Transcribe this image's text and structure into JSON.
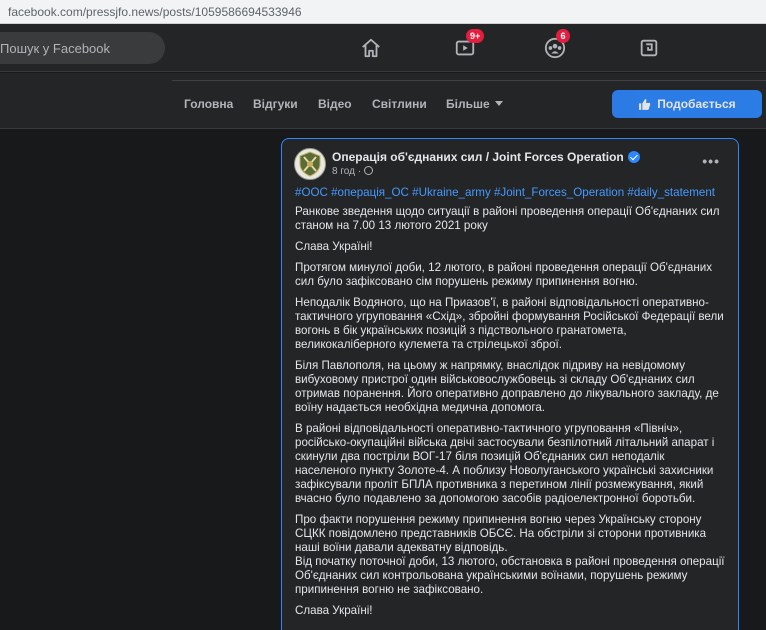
{
  "browser": {
    "url": "facebook.com/pressjfo.news/posts/1059586694533946"
  },
  "topnav": {
    "search_placeholder": "Пошук у Facebook",
    "icons": [
      "home-icon",
      "watch-icon",
      "groups-icon",
      "gaming-icon"
    ],
    "watch_badge": "9+",
    "groups_badge": "6"
  },
  "pagenav": {
    "tabs": [
      "Головна",
      "Відгуки",
      "Відео",
      "Світлини",
      "Більше"
    ],
    "like_button": "Подобається"
  },
  "post": {
    "page_name": "Операція об'єднаних сил / Joint Forces Operation",
    "time": "8 год ·",
    "hashtags": "#ООС #операція_ОС #Ukraine_army #Joint_Forces_Operation #daily_statement",
    "paragraphs": [
      "Ранкове зведення щодо ситуації в районі проведення операції Об'єднаних сил станом на 7.00 13 лютого 2021 року",
      "Слава Україні!",
      "Протягом минулої доби, 12 лютого, в районі проведення операції Об'єднаних сил було зафіксовано сім порушень режиму припинення вогню.",
      "Неподалік Водяного, що на Приазов'ї, в районі відповідальності оперативно-тактичного угруповання «Схід», збройні формування Російської Федерації вели вогонь в бік українських позицій з підствольного гранатомета, великокаліберного кулемета та стрілецької зброї.",
      "Біля Павлополя, на цьому ж напрямку, внаслідок підриву на невідомому вибуховому пристрої один військовослужбовець зі складу Об'єднаних сил отримав поранення. Його оперативно доправлено до лікувального закладу, де воїну надається необхідна медична допомога.",
      "В районі відповідальності оперативно-тактичного угруповання «Північ», російсько-окупаційні війська двічі застосували безпілотний літальний апарат і скинули два постріли ВОГ-17 біля позицій Об'єднаних сил неподалік населеного пункту Золоте-4. А поблизу Новолуганського українські захисники зафіксували проліт БПЛА противника з перетином лінії розмежування, який вчасно було подавлено за допомогою засобів радіоелектронної боротьби.",
      "Про факти порушення режиму припинення вогню через Українську сторону СЦКК повідомлено представників ОБСЄ. На обстріли зі сторони противника наші воїни давали адекватну відповідь.\nВід початку поточної доби, 13 лютого, обстановка в районі проведення операції Об'єднаних сил контрольована українськими воїнами, порушень режиму припинення вогню не зафіксовано.",
      "Слава Україні!"
    ]
  },
  "colors": {
    "accent": "#2d88ff",
    "badge": "#e41e3f",
    "link": "#4599ff"
  }
}
